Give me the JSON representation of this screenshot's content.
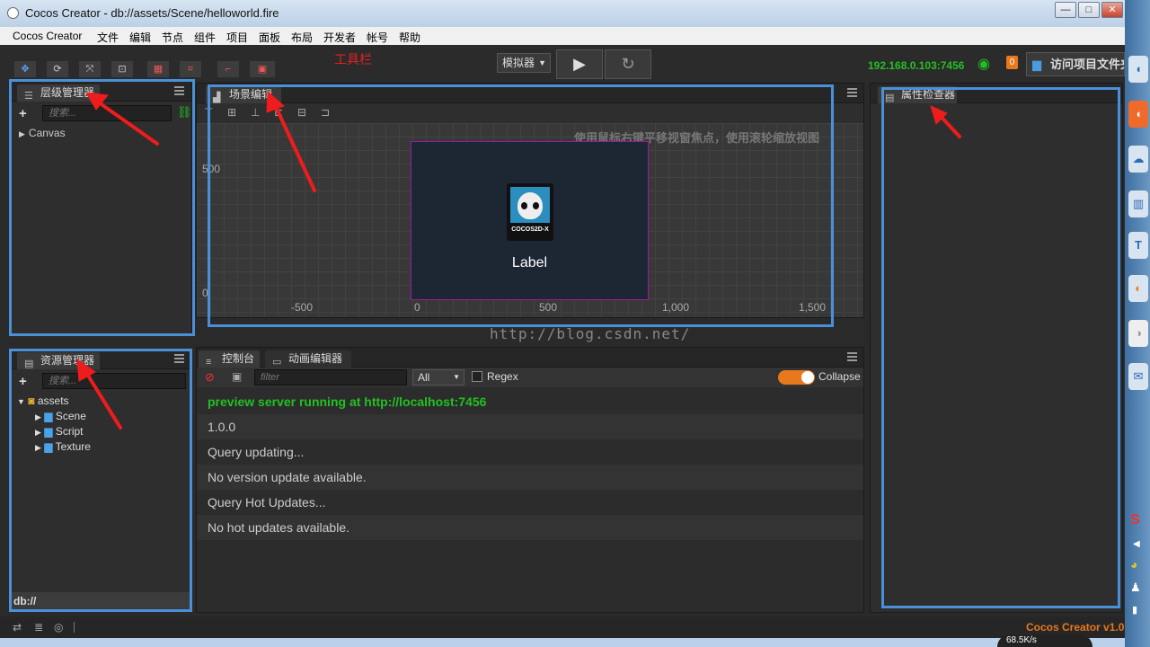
{
  "window": {
    "title": "Cocos Creator - db://assets/Scene/helloworld.fire",
    "min": "—",
    "max": "□",
    "close": "✕"
  },
  "menu": [
    "Cocos Creator",
    "文件",
    "编辑",
    "节点",
    "组件",
    "项目",
    "面板",
    "布局",
    "开发者",
    "帐号",
    "帮助"
  ],
  "toolbar": {
    "annotation": "工具栏",
    "simulator": "模拟器",
    "ip": "192.168.0.103:7456",
    "badge": "0",
    "open_project": "访问项目文件夹"
  },
  "hierarchy": {
    "title": "层级管理器",
    "search_placeholder": "搜索...",
    "items": [
      "Canvas"
    ]
  },
  "assets": {
    "title": "资源管理器",
    "search_placeholder": "搜索...",
    "root": "assets",
    "items": [
      "Scene",
      "Script",
      "Texture"
    ],
    "footer": "db://"
  },
  "scene": {
    "title": "场景编辑器",
    "hint": "使用鼠标右键平移视窗焦点，使用滚轮缩放视图",
    "y_ticks": [
      "500",
      "0"
    ],
    "x_ticks": [
      "-500",
      "0",
      "500",
      "1,000",
      "1,500"
    ],
    "label": "Label",
    "logo_text": "COCOS2D-X"
  },
  "inspector": {
    "title": "属性检查器"
  },
  "console": {
    "tab1": "控制台",
    "tab2": "动画编辑器",
    "filter_placeholder": "filter",
    "level": "All",
    "regex": "Regex",
    "collapse": "Collapse",
    "lines": [
      "preview server running at http://localhost:7456",
      "1.0.0",
      "Query updating...",
      "No version update available.",
      "Query Hot Updates...",
      "No hot updates available."
    ]
  },
  "watermark": "http://blog.csdn.net/",
  "status": {
    "version": "Cocos Creator v1.0"
  },
  "taskbar": {
    "speed": "68.5K/s"
  },
  "colors": {
    "accent_blue": "#4a90d9",
    "green": "#22c022",
    "orange": "#e8781e"
  }
}
